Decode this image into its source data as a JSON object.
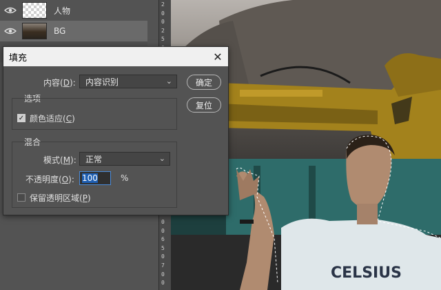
{
  "layers": [
    {
      "name": "人物",
      "selected": false,
      "thumb": "transparent"
    },
    {
      "name": "BG",
      "selected": true,
      "thumb": "photo"
    }
  ],
  "ruler_numbers": [
    "2",
    "0",
    "0",
    "2",
    "5",
    "0",
    "3",
    "0",
    "0",
    "3",
    "5",
    "0",
    "4",
    "0",
    "0",
    "4",
    "5",
    "0",
    "5",
    "0",
    "0",
    "5",
    "5",
    "0",
    "6",
    "0",
    "0",
    "6",
    "5",
    "0",
    "7",
    "0",
    "0"
  ],
  "dialog": {
    "title": "填充",
    "close_symbol": "✕",
    "content_label": "内容(",
    "content_key": "D",
    "content_suffix": "):",
    "content_value": "内容识别",
    "ok_label": "确定",
    "reset_label": "复位",
    "options_title": "选项",
    "color_adapt_label": "颜色适应(",
    "color_adapt_key": "C",
    "color_adapt_suffix": ")",
    "color_adapt_checked": true,
    "blend_title": "混合",
    "mode_label": "模式(",
    "mode_key": "M",
    "mode_suffix": "):",
    "mode_value": "正常",
    "opacity_label": "不透明度(",
    "opacity_key": "O",
    "opacity_suffix": "):",
    "opacity_value": "100",
    "opacity_unit": "%",
    "preserve_label": "保留透明区域(",
    "preserve_key": "P",
    "preserve_suffix": ")",
    "preserve_checked": false
  },
  "canvas": {
    "shirt_text": "CELSIUS"
  },
  "colors": {
    "panel": "#535353",
    "accent_blue": "#1e5fb3",
    "excavator_yellow": "#a3821c",
    "teal_wall": "#2e6c6a"
  }
}
